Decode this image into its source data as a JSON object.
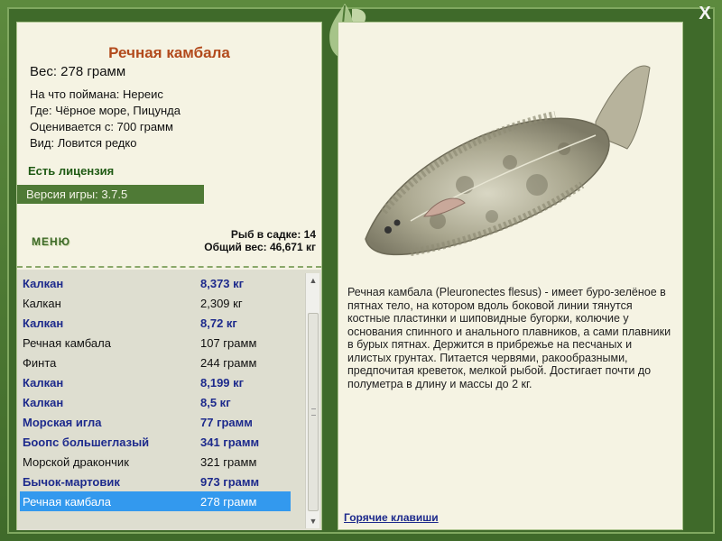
{
  "window": {
    "close_label": "X"
  },
  "fish": {
    "title": "Речная камбала",
    "weight_line": "Вес: 278 грамм",
    "caught_on": "На что поймана: Нереис",
    "where": "Где: Чёрное море, Пицунда",
    "valued_from": "Оценивается с: 700 грамм",
    "kind": "Вид: Ловится редко"
  },
  "license": "Есть лицензия",
  "version": "Версия игры: 3.7.5",
  "menu_label": "МЕНЮ",
  "keep": {
    "fish_count": "Рыб в садке: 14",
    "total_weight": "Общий вес: 46,671 кг"
  },
  "catch_list": [
    {
      "name": "Калкан",
      "weight": "8,373 кг",
      "style": "bold"
    },
    {
      "name": "Калкан",
      "weight": "2,309 кг",
      "style": "normal"
    },
    {
      "name": "Калкан",
      "weight": "8,72 кг",
      "style": "bold"
    },
    {
      "name": "Речная камбала",
      "weight": "107 грамм",
      "style": "normal"
    },
    {
      "name": "Финта",
      "weight": "244 грамм",
      "style": "normal"
    },
    {
      "name": "Калкан",
      "weight": "8,199 кг",
      "style": "bold"
    },
    {
      "name": "Калкан",
      "weight": "8,5 кг",
      "style": "bold"
    },
    {
      "name": "Морская игла",
      "weight": "77 грамм",
      "style": "bold"
    },
    {
      "name": "Боопс большеглазый",
      "weight": "341 грамм",
      "style": "bold"
    },
    {
      "name": "Морской дракончик",
      "weight": "321 грамм",
      "style": "normal"
    },
    {
      "name": "Бычок-мартовик",
      "weight": "973 грамм",
      "style": "bold"
    },
    {
      "name": "Речная камбала",
      "weight": "278 грамм",
      "style": "selected"
    }
  ],
  "description": "Речная камбала (Pleuronectes flesus) - имеет буро-зелёное в пятнах тело, на котором вдоль боковой линии тянутся костные пластинки и шиповидные бугорки, колючие у основания спинного и анального плавников, а сами плавники в бурых пятнах. Держится в прибрежье на песчаных и илистых грунтах. Питается червями, ракообразными, предпочитая креветок, мелкой рыбой. Достигает почти до полуметра в длину и массы до 2 кг.",
  "hotkeys_label": "Горячие клавиши",
  "colors": {
    "frame": "#4f7a36",
    "panel": "#f5f3e3",
    "title": "#b24a1c",
    "bold_entry": "#1d2a8c",
    "selection": "#3399ee"
  },
  "icons": [
    "close-icon",
    "leaf-icon",
    "scroll-up-icon",
    "scroll-down-icon"
  ]
}
